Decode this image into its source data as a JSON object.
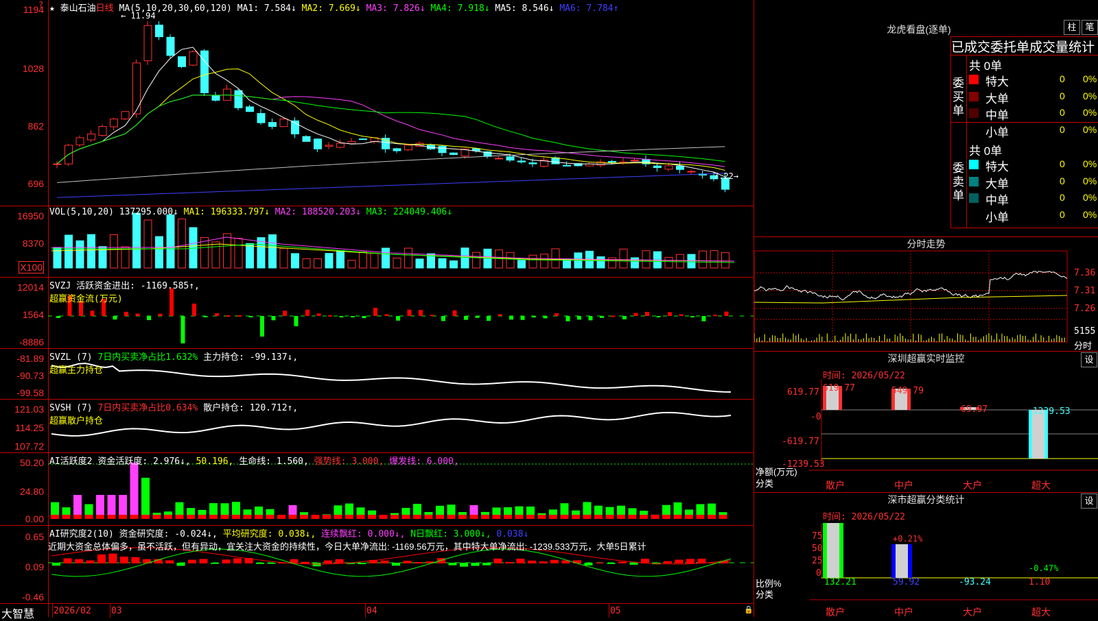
{
  "app_name": "大智慧",
  "stock_name": "泰山石油",
  "period": "日线",
  "main_chart": {
    "ma_title": "MA(5,10,20,30,60,120)",
    "ma1": "MA1: 7.584↓",
    "ma2": "MA2: 7.669↓",
    "ma3": "MA3: 7.826↓",
    "ma4": "MA4: 7.918↓",
    "ma5": "MA5: 8.546↓",
    "ma6": "MA6: 7.784↑",
    "y_labels": [
      "1194",
      "1028",
      "862",
      "696"
    ],
    "high_label": "11.94",
    "last_price_label": "7.22→"
  },
  "vol_pane": {
    "title": "VOL(5,10,20)",
    "value": "137295.000↓",
    "ma1": "MA1: 196333.797↓",
    "ma2": "MA2: 188520.203↓",
    "ma3": "MA3: 224049.406↓",
    "y_labels": [
      "16950",
      "8370",
      "X100"
    ]
  },
  "svzj_pane": {
    "title": "SVZJ",
    "line1": "活跃资金进出: -1169.585↑,",
    "line2": "超赢资金流(万元)",
    "y_labels": [
      "12014",
      "1564",
      "-8886"
    ]
  },
  "svzl_pane": {
    "title": "SVZL (7)",
    "ratio": "7日内买卖净占比1.632%",
    "hold": "主力持仓: -99.137↓,",
    "line2": "超赢主力持仓",
    "y_labels": [
      "-81.89",
      "-90.73",
      "-99.58"
    ]
  },
  "svsh_pane": {
    "title": "SVSH (7)",
    "ratio": "7日内买卖净占比0.634%",
    "hold": "散户持仓: 120.712↑,",
    "line2": "超赢散户持仓",
    "y_labels": [
      "121.03",
      "114.25",
      "107.72"
    ]
  },
  "ai_active_pane": {
    "title": "AI活跃度2",
    "v1": "资金活跃度: 2.976↓,",
    "v2": "50.196,",
    "v3": "生命线: 1.560,",
    "v4": "强势线: 3.000,",
    "v5": "爆发线: 6.000,",
    "y_labels": [
      "50.20",
      "24.80",
      "0.00"
    ]
  },
  "ai_research_pane": {
    "title": "AI研究度2(10)",
    "v1": "资金研究度: -0.024↓,",
    "v2": "平均研究度: 0.038↓,",
    "v3": "连续飘红: 0.000↓,",
    "v4": "N日飘红: 3.000↓,",
    "v5": "0.038↓",
    "comment": "近期大资金总体偏多，虽不活跃，但有异动，宜关注大资金的持续性，今日大单净流出: -1169.56万元，其中特大单净流出: -1239.533万元，大单5日累计",
    "y_labels": [
      "0.65",
      "0.09",
      "-0.46"
    ]
  },
  "date_axis": [
    "2026/02",
    "03",
    "04",
    "05"
  ],
  "longhu": {
    "title": "龙虎看盘(逐单)",
    "tab1": "柱",
    "tab2": "笔",
    "subtitle": "已成交委托单成交量统计",
    "buy_label": "委买单",
    "sell_label": "委卖单",
    "buy_total": "共 0单",
    "sell_total": "共 0单",
    "buy_rows": [
      {
        "name": "特大",
        "count": "0",
        "pct": "0%",
        "color": "#ff0000"
      },
      {
        "name": "大单",
        "count": "0",
        "pct": "0%",
        "color": "#800000"
      },
      {
        "name": "中单",
        "count": "0",
        "pct": "0%",
        "color": "#500000"
      },
      {
        "name": "小单",
        "count": "0",
        "pct": "0%",
        "color": "#000000"
      }
    ],
    "sell_rows": [
      {
        "name": "特大",
        "count": "0",
        "pct": "0%",
        "color": "#00ffff"
      },
      {
        "name": "大单",
        "count": "0",
        "pct": "0%",
        "color": "#008080"
      },
      {
        "name": "中单",
        "count": "0",
        "pct": "0%",
        "color": "#006060"
      },
      {
        "name": "小单",
        "count": "0",
        "pct": "0%",
        "color": "#000000"
      }
    ]
  },
  "intraday": {
    "title": "分时走势",
    "price_labels": [
      "7.36",
      "7.31",
      "7.26"
    ],
    "vol_label": "5155",
    "vol_unit": "分时"
  },
  "monitor": {
    "title": "深圳超赢实时监控",
    "settings": "设",
    "time": "时间: 2026/05/22",
    "y_labels": [
      "619.77",
      "-0",
      "-619.77",
      "-1239.53"
    ],
    "unit": "净额(万元)",
    "cat_label": "分类",
    "bars": [
      {
        "name": "散户",
        "value": "619.77"
      },
      {
        "name": "中户",
        "value": "549.79"
      },
      {
        "name": "大户",
        "value": "69.97"
      },
      {
        "name": "超大",
        "value": "-1239.53"
      }
    ]
  },
  "classify": {
    "title": "深市超赢分类统计",
    "settings": "设",
    "time": "时间: 2026/05/22",
    "y_labels": [
      "75",
      "50",
      "25",
      "0"
    ],
    "unit": "比例%",
    "cat_label": "分类",
    "bars": [
      {
        "name": "散户",
        "value": "132.21"
      },
      {
        "name": "中户",
        "value": "59.92"
      },
      {
        "name": "大户",
        "value": "-93.24"
      },
      {
        "name": "超大",
        "value": "1.10"
      }
    ],
    "annot1": "+0.21%",
    "annot2": "-0.47%"
  },
  "colors": {
    "up": "#ff3030",
    "down": "#40ffff",
    "grid": "#c00000"
  }
}
